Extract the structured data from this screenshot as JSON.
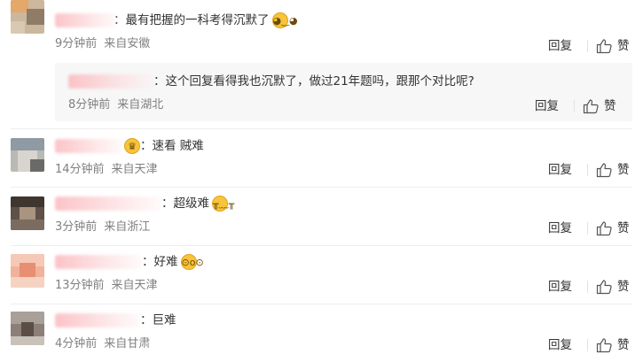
{
  "comments": [
    {
      "username": "二鬼沁",
      "text": "最有把握的一科考得沉默了",
      "emoji": "awkward-face-emoji",
      "time": "9分钟前",
      "location": "来自安徽",
      "reply_label": "回复",
      "like_label": "赞",
      "replies": [
        {
          "username": "不入戏的小卫S",
          "text": "这个回复看得我也沉默了，做过21年题吗，跟那个对比呢?",
          "time": "8分钟前",
          "location": "来自湖北",
          "reply_label": "回复",
          "like_label": "赞"
        }
      ]
    },
    {
      "username": "一个小透明",
      "text": "速看 贼难",
      "emoji": "crown-face-emoji",
      "time": "14分钟前",
      "location": "来自天津",
      "reply_label": "回复",
      "like_label": "赞"
    },
    {
      "username": "一只小可爱e",
      "text": "超级难",
      "emoji": "crying-face-emoji",
      "time": "3分钟前",
      "location": "来自浙江",
      "reply_label": "回复",
      "like_label": "赞"
    },
    {
      "username": "Chitoo_2021_z",
      "text": "好难",
      "emoji": "shocked-face-emoji",
      "time": "13分钟前",
      "location": "来自天津",
      "reply_label": "回复",
      "like_label": "赞"
    },
    {
      "username": "l今天也要努力呀",
      "text": "巨难",
      "time": "4分钟前",
      "location": "来自甘肃",
      "reply_label": "回复",
      "like_label": "赞"
    }
  ],
  "colors": {
    "username": "#e86b5a",
    "meta": "#808080",
    "text": "#333333",
    "divider": "#eeeeee",
    "subreply_bg": "#f7f7f7"
  }
}
